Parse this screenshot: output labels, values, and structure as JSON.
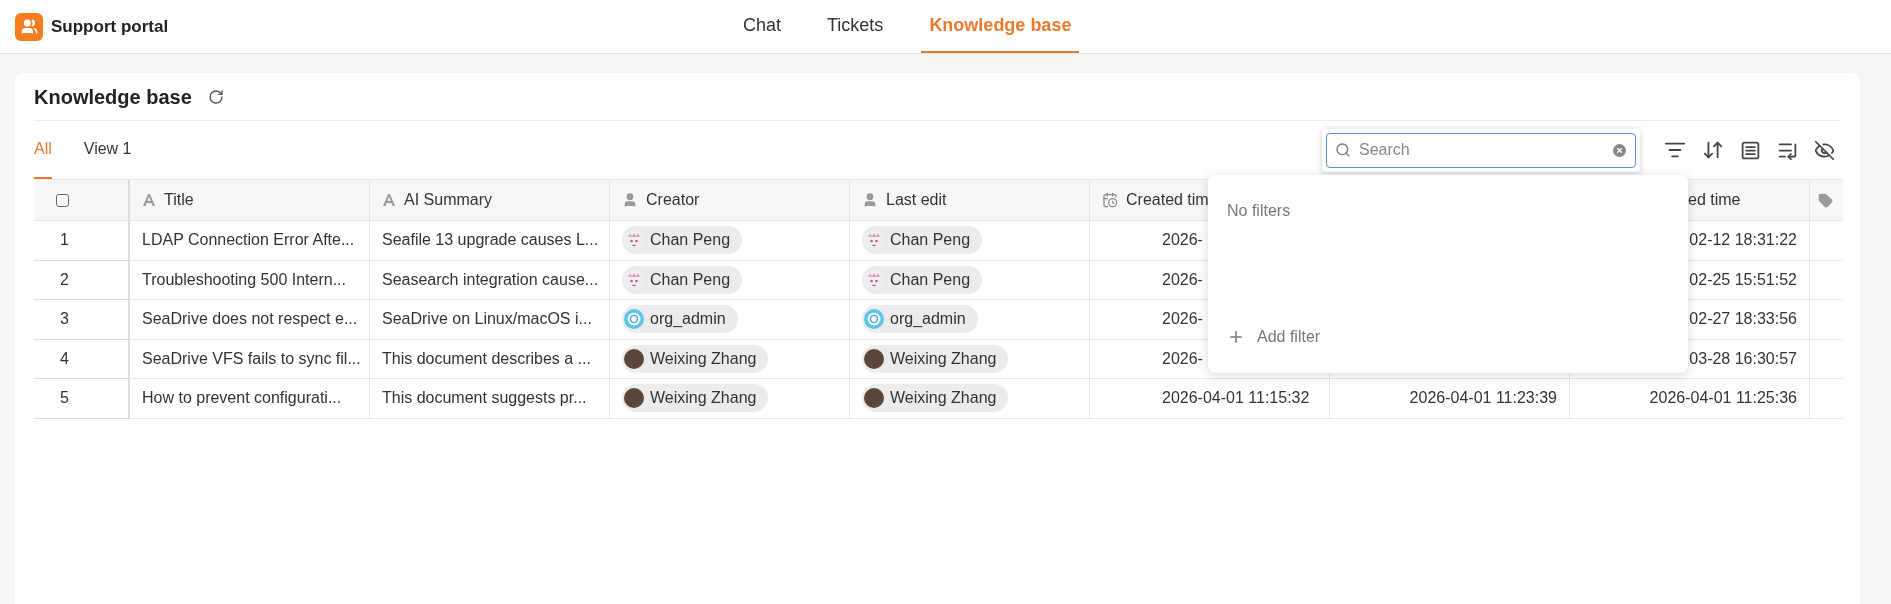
{
  "app": {
    "title": "Support portal"
  },
  "nav": [
    {
      "label": "Chat",
      "selected": false
    },
    {
      "label": "Tickets",
      "selected": false
    },
    {
      "label": "Knowledge base",
      "selected": true
    }
  ],
  "page": {
    "title": "Knowledge base"
  },
  "views": [
    {
      "label": "All",
      "selected": true
    },
    {
      "label": "View 1",
      "selected": false
    }
  ],
  "search": {
    "placeholder": "Search"
  },
  "table": {
    "all_checked": false,
    "columns": [
      {
        "kind": "text",
        "label": "Title"
      },
      {
        "kind": "text",
        "label": "AI Summary"
      },
      {
        "kind": "person",
        "label": "Creator"
      },
      {
        "kind": "person",
        "label": "Last edit"
      },
      {
        "kind": "date",
        "label": "Created tim"
      },
      {
        "kind": "covered"
      },
      {
        "kind": "cut",
        "label": "ed time"
      },
      {
        "kind": "tag"
      }
    ],
    "rows": [
      {
        "number": "1",
        "cells": [
          "LDAP Connection Error Afte...",
          "Seafile 13 upgrade causes L...",
          {
            "name": "Chan Peng",
            "kind": "cartoon"
          },
          {
            "name": "Chan Peng",
            "kind": "cartoon"
          },
          "2026-",
          null,
          "02-12 18:31:22"
        ]
      },
      {
        "number": "2",
        "cells": [
          "Troubleshooting 500 Intern...",
          "Seasearch integration cause...",
          {
            "name": "Chan Peng",
            "kind": "cartoon"
          },
          {
            "name": "Chan Peng",
            "kind": "cartoon"
          },
          "2026-",
          null,
          "02-25 15:51:52"
        ]
      },
      {
        "number": "3",
        "cells": [
          "SeaDrive does not respect e...",
          "SeaDrive on Linux/macOS i...",
          {
            "name": "org_admin",
            "kind": "logo"
          },
          {
            "name": "org_admin",
            "kind": "logo"
          },
          "2026-",
          null,
          "02-27 18:33:56"
        ]
      },
      {
        "number": "4",
        "cells": [
          "SeaDrive VFS fails to sync fil...",
          "This document describes a ...",
          {
            "name": "Weixing Zhang",
            "kind": "photo"
          },
          {
            "name": "Weixing Zhang",
            "kind": "photo"
          },
          "2026-",
          null,
          "03-28 16:30:57"
        ]
      },
      {
        "number": "5",
        "cells": [
          "How to prevent configurati...",
          "This document suggests pr...",
          {
            "name": "Weixing Zhang",
            "kind": "photo"
          },
          {
            "name": "Weixing Zhang",
            "kind": "photo"
          },
          "2026-04-01 11:15:32",
          "2026-04-01 11:23:39",
          "2026-04-01 11:25:36"
        ]
      }
    ]
  },
  "filter_popup": {
    "empty_text": "No filters",
    "add_label": "Add filter"
  }
}
